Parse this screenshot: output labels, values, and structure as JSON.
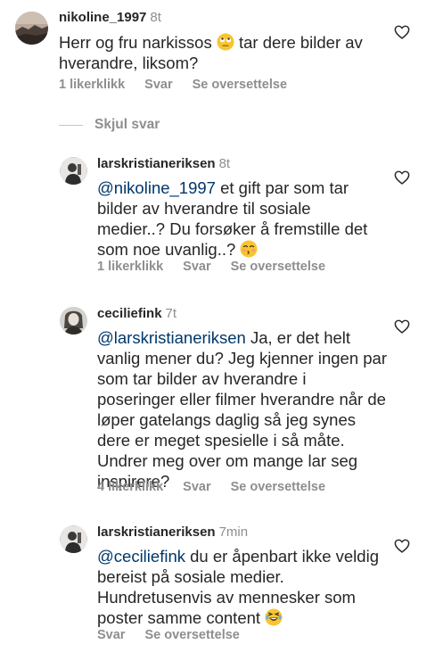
{
  "comments": [
    {
      "username": "nikoline_1997",
      "time": "8t",
      "text_before_emoji": "Herr og fru narkissos ",
      "emoji": "eye-roll-emoji",
      "text_after_emoji": " tar dere bilder av hverandre, liksom?",
      "likes": "1 likerklikk",
      "reply": "Svar",
      "translate": "Se oversettelse"
    },
    {
      "username": "larskristianeriksen",
      "time": "8t",
      "mention": "@nikoline_1997",
      "text": " et gift par som tar bilder av hverandre til sosiale medier..? Du forsøker å fremstille det som noe uvanlig..? ",
      "emoji": "kissing-emoji",
      "likes": "1 likerklikk",
      "reply": "Svar",
      "translate": "Se oversettelse"
    },
    {
      "username": "ceciliefink",
      "time": "7t",
      "mention": "@larskristianeriksen",
      "text": " Ja, er det helt vanlig mener du? Jeg kjenner ingen par som tar bilder av hverandre i poseringer eller filmer hverandre når de løper gatelangs daglig så jeg synes dere er meget spesielle i så måte. Undrer meg over om mange lar seg inspirere?",
      "likes": "4 likerklikk",
      "reply": "Svar",
      "translate": "Se oversettelse"
    },
    {
      "username": "larskristianeriksen",
      "time": "7min",
      "mention": "@ceciliefink",
      "text": " du er åpenbart ikke veldig bereist på sosiale medier. Hundretusenvis av mennesker som poster samme content ",
      "emoji": "laughing-tears-emoji",
      "reply": "Svar",
      "translate": "Se oversettelse"
    }
  ],
  "hide_replies_label": "Skjul svar",
  "colors": {
    "text": "#262626",
    "secondary": "#8e8e8e",
    "mention": "#00376b",
    "emoji": "#f7c531"
  }
}
